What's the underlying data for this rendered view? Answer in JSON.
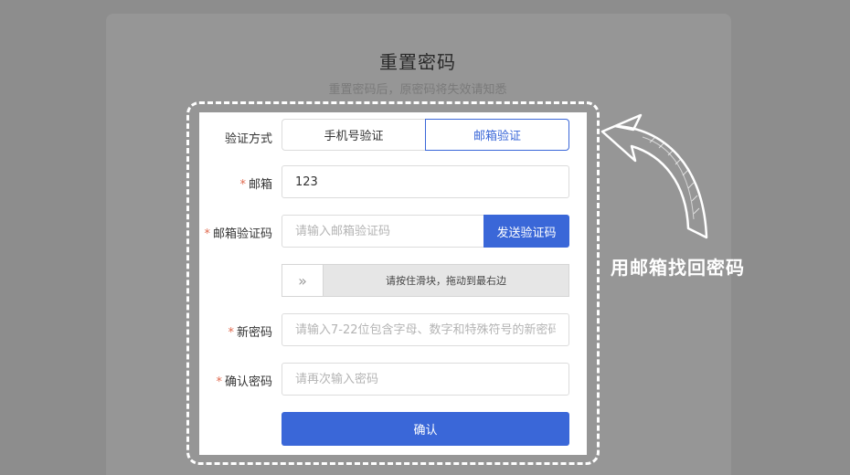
{
  "header": {
    "title": "重置密码",
    "subtitle": "重置密码后，原密码将失效请知悉"
  },
  "form": {
    "method_label": "验证方式",
    "tabs": [
      {
        "label": "手机号验证",
        "active": false
      },
      {
        "label": "邮箱验证",
        "active": true
      }
    ],
    "email_label": "邮箱",
    "email_value": "123",
    "code_label": "邮箱验证码",
    "code_placeholder": "请输入邮箱验证码",
    "send_code_label": "发送验证码",
    "slider_handle_glyph": "»",
    "slider_text": "请按住滑块，拖动到最右边",
    "new_password_label": "新密码",
    "new_password_placeholder": "请输入7-22位包含字母、数字和特殊符号的新密码",
    "confirm_password_label": "确认密码",
    "confirm_password_placeholder": "请再次输入密码",
    "confirm_label": "确认",
    "required_mark": "*"
  },
  "annotation": {
    "text": "用邮箱找回密码"
  },
  "colors": {
    "accent": "#3a67d8",
    "overlay": "#8d8d8d",
    "required": "#e06a4f"
  }
}
